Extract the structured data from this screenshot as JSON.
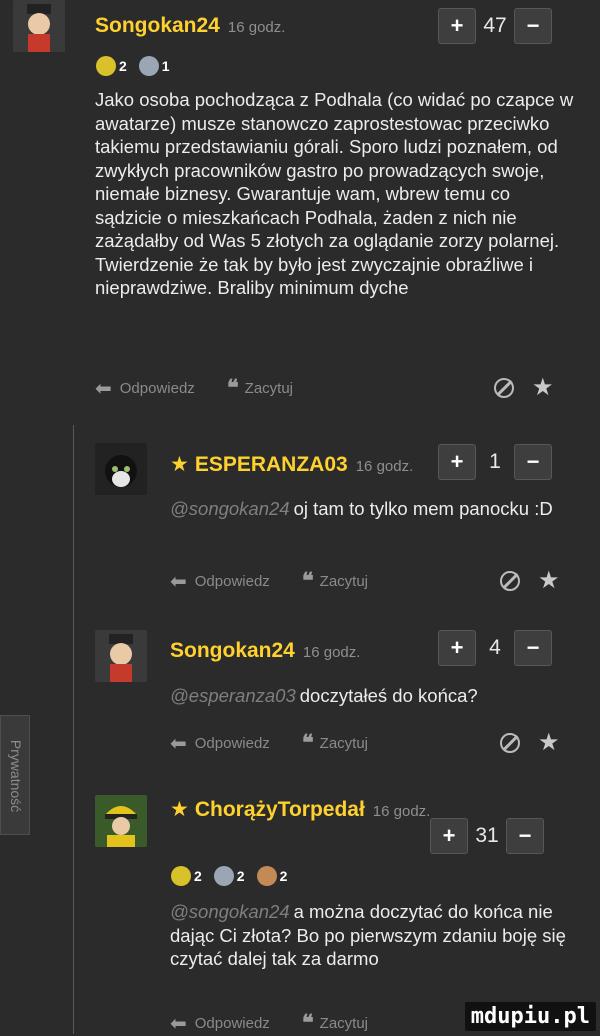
{
  "comments": [
    {
      "author": "Songokan24",
      "star": "",
      "time": "16 godz.",
      "votes": "47",
      "badges": [
        {
          "count": "2",
          "color": "#d8c12a"
        },
        {
          "count": "1",
          "color": "#9aa6b4"
        }
      ],
      "mention": "",
      "text": "Jako osoba pochodząca z Podhala (co widać po czapce w awatarze) musze stanowczo zaprostestowac przeciwko takiemu przedstawianiu górali. Sporo ludzi poznałem, od zwykłych pracowników gastro po prowadzących swoje, niemałe biznesy. Gwarantuje wam, wbrew temu co sądzicie o mieszkańcach Podhala, żaden z nich nie zażądałby od Was 5 złotych za oglądanie zorzy polarnej. Twierdzenie że tak by było jest zwyczajnie obraźliwe i nieprawdziwe. Braliby minimum dyche"
    },
    {
      "author": "ESPERANZA03",
      "star": "★",
      "time": "16 godz.",
      "votes": "1",
      "badges": [],
      "mention": "@songokan24",
      "text": "oj tam to tylko mem panocku :D"
    },
    {
      "author": "Songokan24",
      "star": "",
      "time": "16 godz.",
      "votes": "4",
      "badges": [],
      "mention": "@esperanza03",
      "text": "doczytałeś do końca?"
    },
    {
      "author": "ChorążyTorpedał",
      "star": "★",
      "time": "16 godz.",
      "votes": "31",
      "badges": [
        {
          "count": "2",
          "color": "#d8c12a"
        },
        {
          "count": "2",
          "color": "#9aa6b4"
        },
        {
          "count": "2",
          "color": "#c28a55"
        }
      ],
      "mention": "@songokan24",
      "text": "a można doczytać do końca nie dając Ci złota? Bo po pierwszym zdaniu boję się czytać dalej tak za darmo"
    }
  ],
  "actions": {
    "reply": "Odpowiedz",
    "quote": "Zacytuj"
  },
  "vote_plus": "+",
  "vote_minus": "−",
  "quote_glyph": "❝",
  "reply_glyph": "⬅",
  "privacy_label": "Prywatność",
  "watermark": "mdupiu.pl",
  "colors": {
    "background": "#2b2b2b",
    "author": "#ffd12e",
    "mention": "#7f7f7f"
  }
}
